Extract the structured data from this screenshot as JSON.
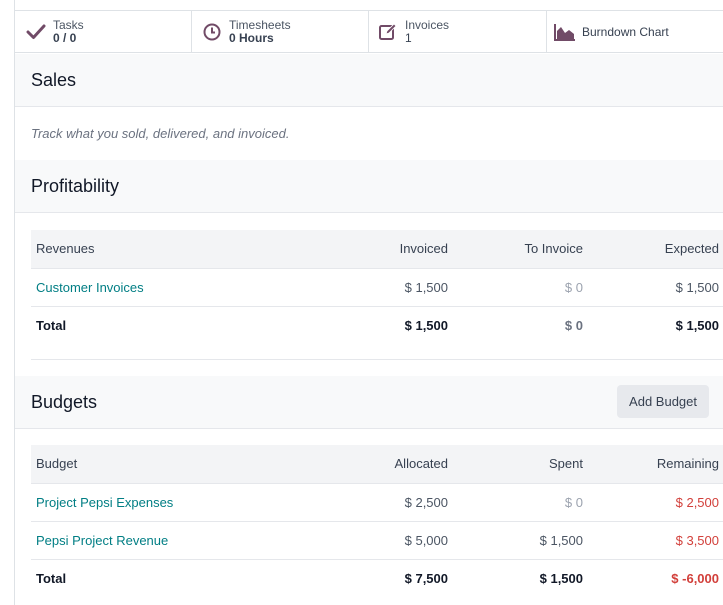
{
  "stat_buttons": {
    "tasks": {
      "label": "Tasks",
      "value": "0 / 0",
      "icon": "check-icon"
    },
    "timesheets": {
      "label": "Timesheets",
      "value": "0 Hours",
      "icon": "clock-icon"
    },
    "invoices": {
      "label": "Invoices",
      "value": "1",
      "icon": "edit-icon"
    },
    "burndown": {
      "label": "Burndown Chart",
      "icon": "area-chart-icon"
    }
  },
  "sales": {
    "title": "Sales",
    "description": "Track what you sold, delivered, and invoiced."
  },
  "profitability": {
    "title": "Profitability",
    "columns": [
      "Revenues",
      "Invoiced",
      "To Invoice",
      "Expected"
    ],
    "rows": [
      {
        "name": "Customer Invoices",
        "invoiced": "$ 1,500",
        "to_invoice": "$ 0",
        "expected": "$ 1,500"
      }
    ],
    "total": {
      "name": "Total",
      "invoiced": "$ 1,500",
      "to_invoice": "$ 0",
      "expected": "$ 1,500"
    }
  },
  "budgets": {
    "title": "Budgets",
    "add_button": "Add Budget",
    "columns": [
      "Budget",
      "Allocated",
      "Spent",
      "Remaining"
    ],
    "rows": [
      {
        "name": "Project Pepsi Expenses",
        "allocated": "$ 2,500",
        "spent": "$ 0",
        "remaining": "$ 2,500"
      },
      {
        "name": "Pepsi Project Revenue",
        "allocated": "$ 5,000",
        "spent": "$ 1,500",
        "remaining": "$ 3,500"
      }
    ],
    "total": {
      "name": "Total",
      "allocated": "$ 7,500",
      "spent": "$ 1,500",
      "remaining": "$ -6,000"
    }
  },
  "colors": {
    "icon": "#714b67",
    "link": "#017e84",
    "negative": "#d23f3a"
  }
}
